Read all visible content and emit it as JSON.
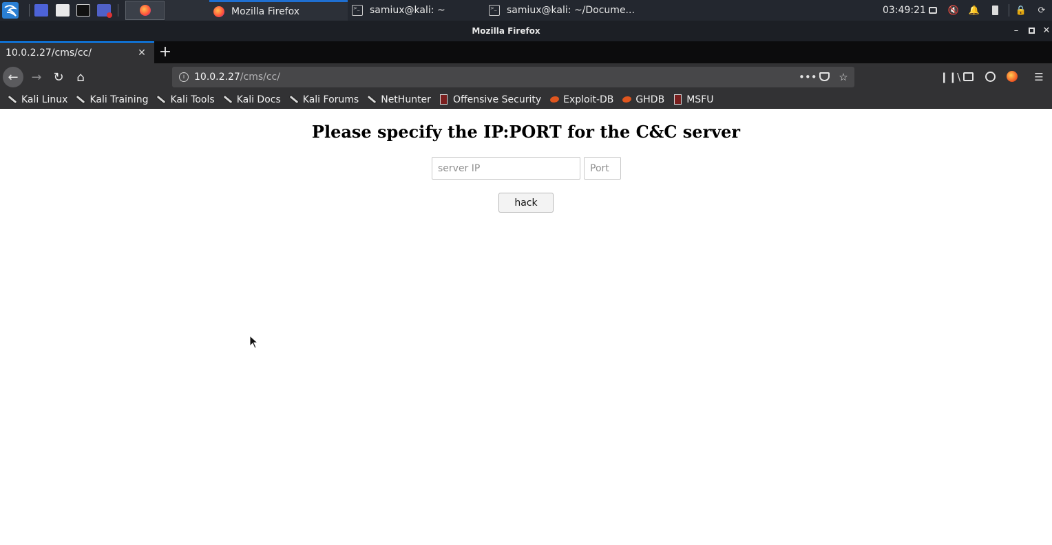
{
  "panel": {
    "tasks": [
      {
        "label": "Mozilla Firefox",
        "icon": "firefox-icon",
        "active": true
      },
      {
        "label": "samiux@kali: ~",
        "icon": "terminal-icon",
        "active": false
      },
      {
        "label": "samiux@kali: ~/Docume...",
        "icon": "terminal-icon",
        "active": false
      }
    ],
    "clock": "03:49:21"
  },
  "window": {
    "title": "Mozilla Firefox"
  },
  "tabs": [
    {
      "label": "10.0.2.27/cms/cc/"
    }
  ],
  "urlbar": {
    "host": "10.0.2.27",
    "path": "/cms/cc/"
  },
  "bookmarks": [
    {
      "label": "Kali Linux",
      "icon": "kali-dragon-icon"
    },
    {
      "label": "Kali Training",
      "icon": "kali-dragon-icon"
    },
    {
      "label": "Kali Tools",
      "icon": "kali-dragon-icon"
    },
    {
      "label": "Kali Docs",
      "icon": "kali-dragon-icon"
    },
    {
      "label": "Kali Forums",
      "icon": "kali-dragon-icon"
    },
    {
      "label": "NetHunter",
      "icon": "kali-dragon-icon"
    },
    {
      "label": "Offensive Security",
      "icon": "offsec-icon"
    },
    {
      "label": "Exploit-DB",
      "icon": "exploit-db-icon"
    },
    {
      "label": "GHDB",
      "icon": "exploit-db-icon"
    },
    {
      "label": "MSFU",
      "icon": "offsec-icon"
    }
  ],
  "page": {
    "heading": "Please specify the IP:PORT for the C&C server",
    "ip_placeholder": "server IP",
    "port_placeholder": "Port",
    "submit_label": "hack"
  },
  "colors": {
    "accent": "#0a84ff",
    "panel_bg": "#23272f",
    "toolbar_bg": "#323234"
  }
}
